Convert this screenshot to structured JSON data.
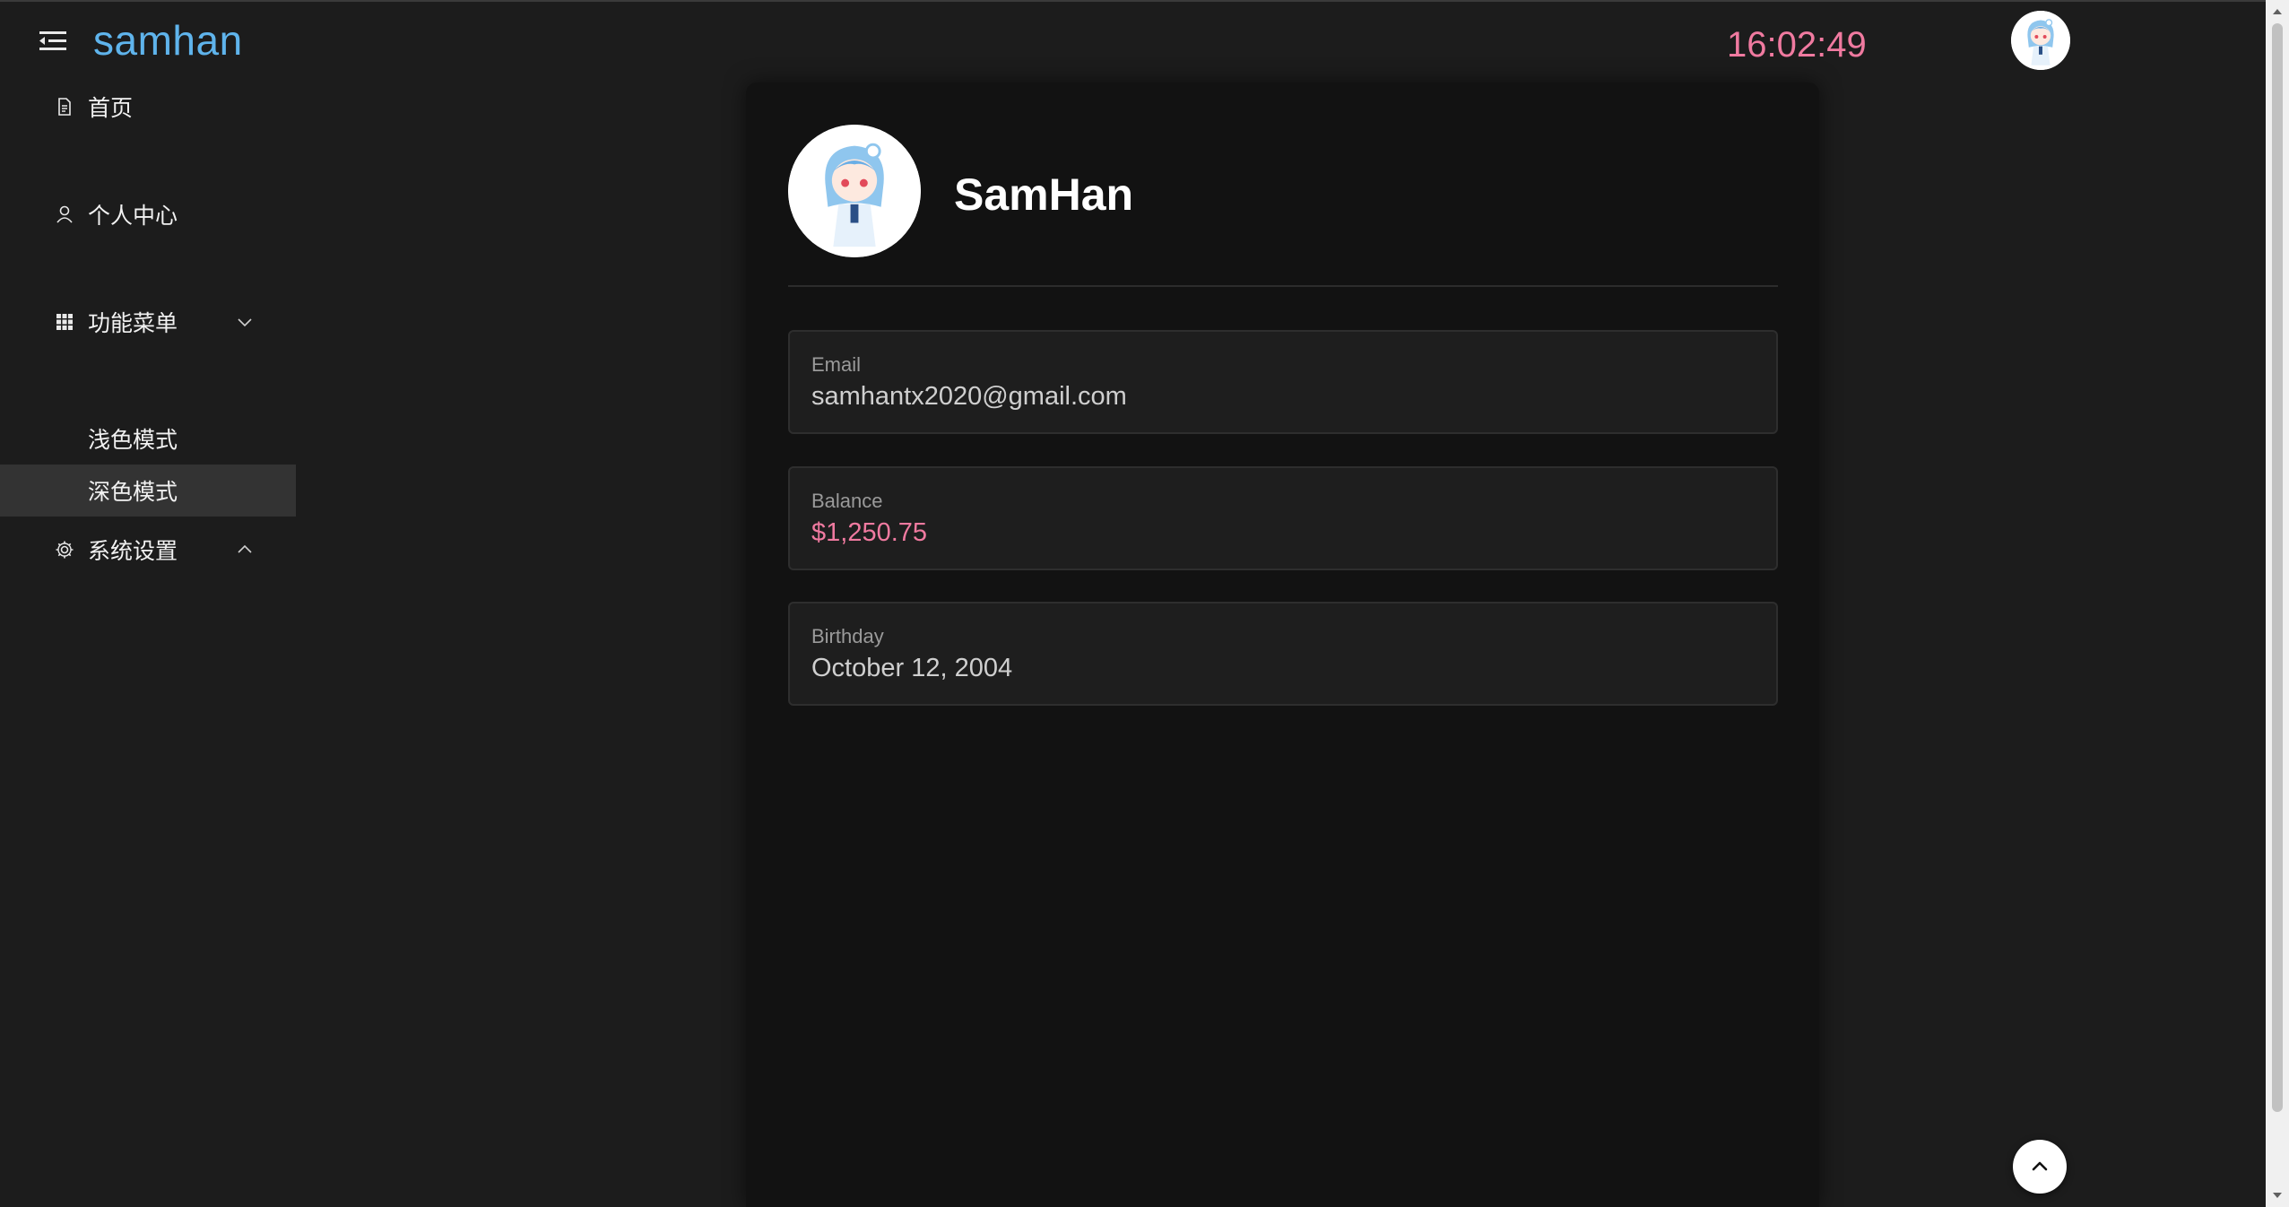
{
  "app": {
    "logo": "samhan",
    "clock": "16:02:49"
  },
  "icons": {
    "menu": "menu-collapse-icon",
    "home": "document-icon",
    "profile": "user-icon",
    "menu_group": "grid-icon",
    "settings": "gear-icon",
    "expand": "chevron-down-icon",
    "collapse": "chevron-up-icon",
    "scroll_top": "chevron-up-icon"
  },
  "sidebar": {
    "items": [
      {
        "label": "首页"
      },
      {
        "label": "个人中心"
      },
      {
        "label": "功能菜单"
      },
      {
        "label": "浅色模式"
      },
      {
        "label": "深色模式",
        "active": true
      },
      {
        "label": "系统设置"
      }
    ]
  },
  "profile": {
    "name": "SamHan",
    "fields": [
      {
        "label": "Email",
        "value": "samhantx2020@gmail.com"
      },
      {
        "label": "Balance",
        "value": "$1,250.75"
      },
      {
        "label": "Birthday",
        "value": "October 12, 2004"
      }
    ]
  },
  "colors": {
    "accent": "#f07aa0",
    "logo": "#5fb4ec",
    "background": "#1c1c1c",
    "card": "#121212"
  }
}
